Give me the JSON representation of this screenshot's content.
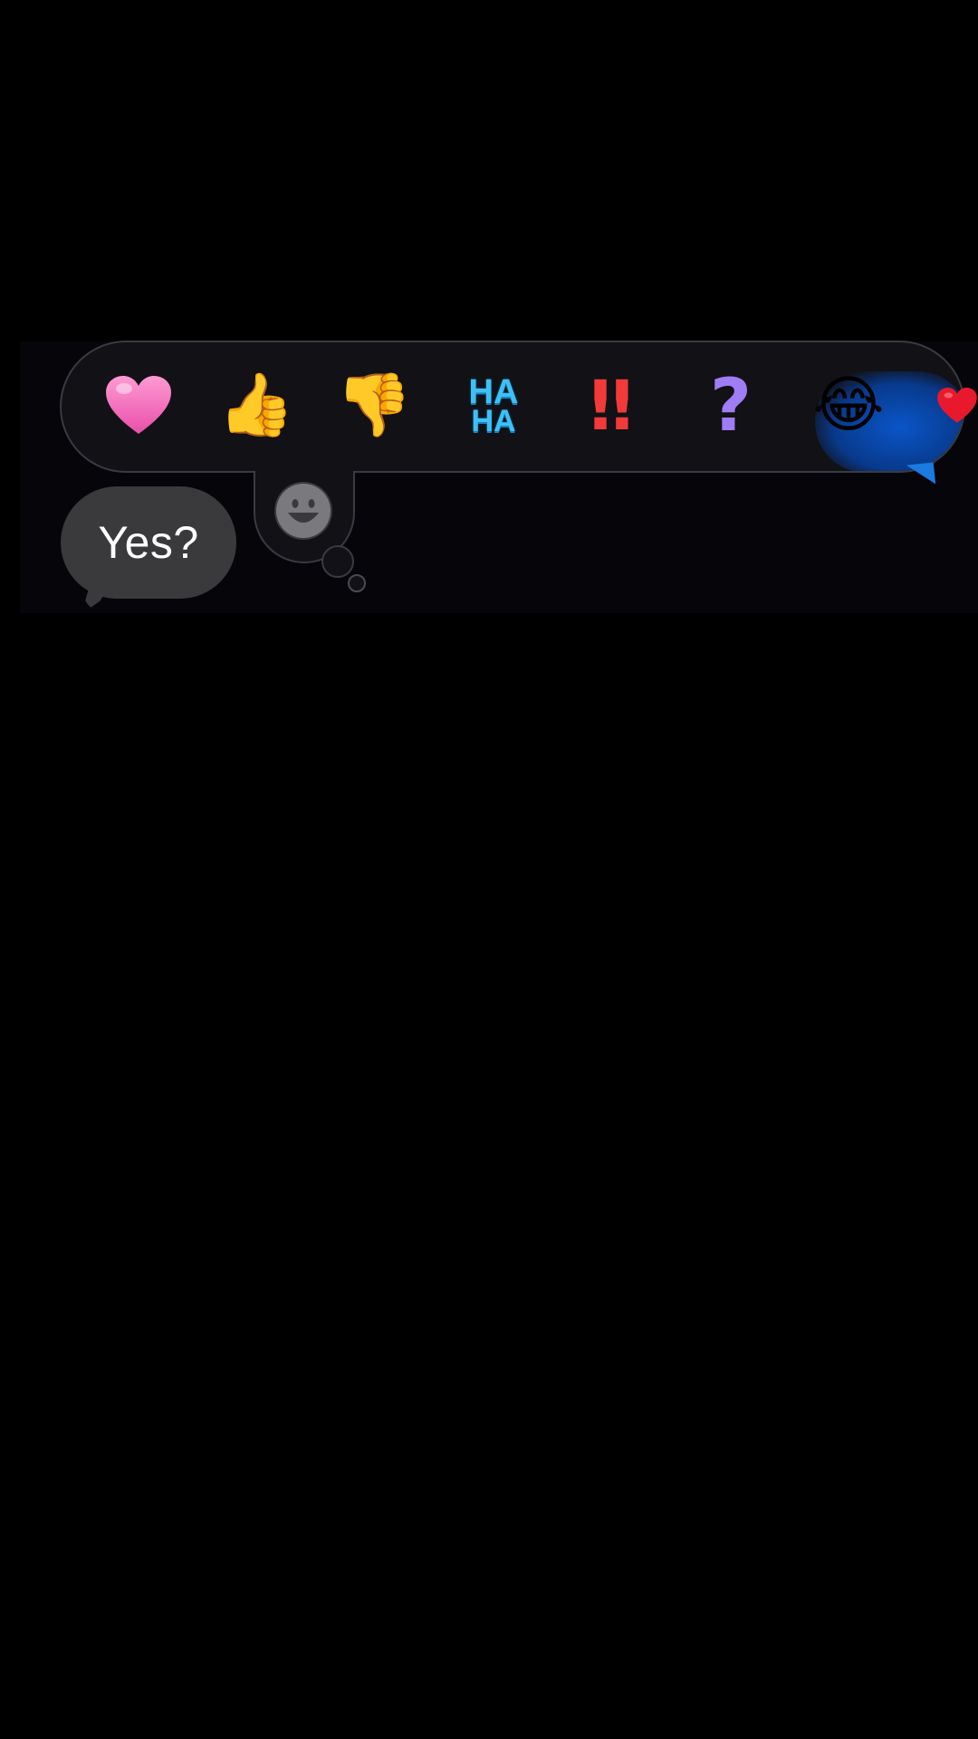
{
  "tapback": {
    "reactions": [
      {
        "name": "heart",
        "glyph": "❤",
        "color": "#f36fb8"
      },
      {
        "name": "thumbs-up",
        "glyph": "👍",
        "color": "#f7b32b"
      },
      {
        "name": "thumbs-down",
        "glyph": "👎",
        "color": "#f28a22"
      },
      {
        "name": "haha",
        "line1": "HA",
        "line2": "HA",
        "color": "#3fc0f5"
      },
      {
        "name": "exclamation",
        "glyph": "‼",
        "color": "#f23a3a"
      },
      {
        "name": "question",
        "glyph": "?",
        "color": "#a07cf5"
      },
      {
        "name": "laughing",
        "glyph": "😂",
        "color": "#f7c52b"
      },
      {
        "name": "red-heart",
        "glyph": "❤",
        "color": "#e8192c"
      }
    ],
    "selected": "laughing",
    "accent": "#0a55c8"
  },
  "message": {
    "text": "Yes?",
    "bubble_color": "#3a3a3c"
  },
  "emoji_picker_icon": "smiley-face-icon"
}
